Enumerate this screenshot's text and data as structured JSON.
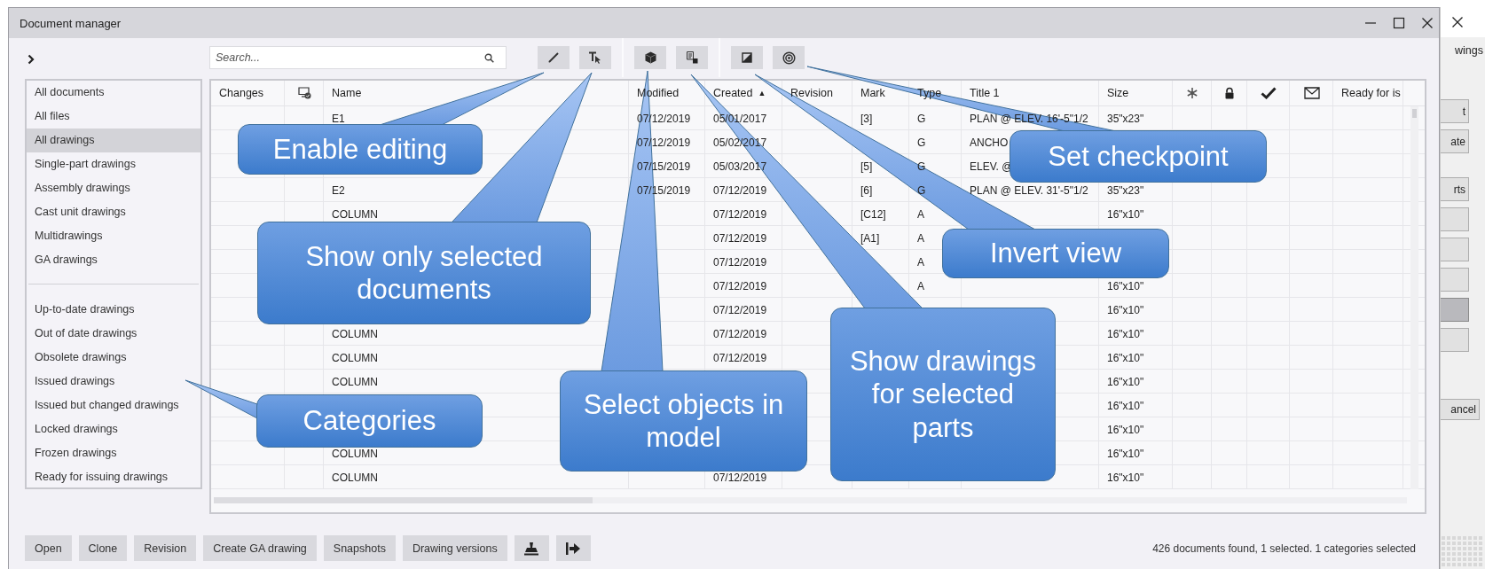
{
  "window": {
    "title": "Document manager"
  },
  "search": {
    "placeholder": "Search..."
  },
  "sidebar": {
    "groups": [
      {
        "items": [
          {
            "label": "All documents",
            "selected": false
          },
          {
            "label": "All files",
            "selected": false
          },
          {
            "label": "All drawings",
            "selected": true
          },
          {
            "label": "Single-part drawings",
            "selected": false
          },
          {
            "label": "Assembly drawings",
            "selected": false
          },
          {
            "label": "Cast unit drawings",
            "selected": false
          },
          {
            "label": "Multidrawings",
            "selected": false
          },
          {
            "label": "GA drawings",
            "selected": false
          }
        ]
      },
      {
        "items": [
          {
            "label": "Up-to-date drawings",
            "selected": false
          },
          {
            "label": "Out of date drawings",
            "selected": false
          },
          {
            "label": "Obsolete drawings",
            "selected": false
          },
          {
            "label": "Issued drawings",
            "selected": false
          },
          {
            "label": "Issued but changed drawings",
            "selected": false
          },
          {
            "label": "Locked drawings",
            "selected": false
          },
          {
            "label": "Frozen drawings",
            "selected": false
          },
          {
            "label": "Ready for issuing drawings",
            "selected": false
          }
        ]
      }
    ]
  },
  "table": {
    "columns": [
      {
        "kind": "text",
        "label": "Changes"
      },
      {
        "kind": "icon"
      },
      {
        "kind": "text",
        "label": "Name"
      },
      {
        "kind": "text",
        "label": "Modified"
      },
      {
        "kind": "text",
        "label": "Created",
        "sort_indicator": "▲"
      },
      {
        "kind": "text",
        "label": "Revision"
      },
      {
        "kind": "text",
        "label": "Mark"
      },
      {
        "kind": "text",
        "label": "Type"
      },
      {
        "kind": "text",
        "label": "Title 1"
      },
      {
        "kind": "text",
        "label": "Size"
      },
      {
        "kind": "icon"
      },
      {
        "kind": "icon"
      },
      {
        "kind": "icon"
      },
      {
        "kind": "icon"
      },
      {
        "kind": "text",
        "label": "Ready for is"
      }
    ],
    "rows": [
      {
        "cells": [
          null,
          null,
          "E1",
          "07/12/2019",
          "05/01/2017",
          null,
          "[3]",
          "G",
          "PLAN @ ELEV. 16'-5\"1/2",
          "35\"x23\""
        ]
      },
      {
        "cells": [
          null,
          null,
          null,
          "07/12/2019",
          "05/02/2017",
          null,
          null,
          "G",
          "ANCHO",
          null
        ]
      },
      {
        "cells": [
          null,
          null,
          null,
          "07/15/2019",
          "05/03/2017",
          null,
          "[5]",
          "G",
          "ELEV. @",
          null
        ]
      },
      {
        "cells": [
          null,
          null,
          "E2",
          "07/15/2019",
          "07/12/2019",
          null,
          "[6]",
          "G",
          "PLAN @ ELEV. 31'-5\"1/2",
          "35\"x23\""
        ]
      },
      {
        "cells": [
          null,
          null,
          "COLUMN",
          null,
          "07/12/2019",
          null,
          "[C12]",
          "A",
          null,
          "16\"x10\""
        ]
      },
      {
        "cells": [
          null,
          null,
          null,
          null,
          "07/12/2019",
          null,
          "[A1]",
          "A",
          null,
          null
        ]
      },
      {
        "cells": [
          null,
          null,
          null,
          null,
          "07/12/2019",
          null,
          null,
          "A",
          null,
          null
        ]
      },
      {
        "cells": [
          null,
          null,
          null,
          null,
          "07/12/2019",
          null,
          null,
          "A",
          null,
          "16\"x10\""
        ]
      },
      {
        "cells": [
          null,
          null,
          null,
          null,
          "07/12/2019",
          null,
          null,
          null,
          null,
          "16\"x10\""
        ]
      },
      {
        "cells": [
          null,
          null,
          "COLUMN",
          null,
          "07/12/2019",
          null,
          null,
          null,
          null,
          "16\"x10\""
        ]
      },
      {
        "cells": [
          null,
          null,
          "COLUMN",
          null,
          "07/12/2019",
          null,
          null,
          null,
          null,
          "16\"x10\""
        ]
      },
      {
        "cells": [
          null,
          null,
          "COLUMN",
          null,
          null,
          null,
          null,
          null,
          null,
          "16\"x10\""
        ]
      },
      {
        "cells": [
          null,
          null,
          null,
          null,
          null,
          null,
          null,
          null,
          null,
          "16\"x10\""
        ]
      },
      {
        "cells": [
          null,
          null,
          null,
          null,
          null,
          null,
          null,
          null,
          null,
          "16\"x10\""
        ]
      },
      {
        "cells": [
          null,
          null,
          "COLUMN",
          null,
          null,
          null,
          null,
          null,
          null,
          "16\"x10\""
        ]
      },
      {
        "cells": [
          null,
          null,
          "COLUMN",
          null,
          "07/12/2019",
          null,
          null,
          null,
          null,
          "16\"x10\""
        ]
      }
    ]
  },
  "bottom_bar": {
    "buttons": [
      {
        "kind": "text",
        "label": "Open"
      },
      {
        "kind": "text",
        "label": "Clone"
      },
      {
        "kind": "text",
        "label": "Revision"
      },
      {
        "kind": "text",
        "label": "Create GA drawing"
      },
      {
        "kind": "text",
        "label": "Snapshots"
      },
      {
        "kind": "text",
        "label": "Drawing versions"
      },
      {
        "kind": "icon"
      },
      {
        "kind": "icon"
      }
    ],
    "status": "426 documents found, 1 selected. 1 categories selected"
  },
  "callouts": [
    {
      "text": "Enable editing"
    },
    {
      "text": "Show only selected documents"
    },
    {
      "text": "Categories"
    },
    {
      "text": "Select objects in model"
    },
    {
      "text": "Show drawings for selected parts"
    },
    {
      "text": "Invert view"
    },
    {
      "text": "Set checkpoint"
    }
  ],
  "background_window": {
    "heading": "wings",
    "buttons": [
      {
        "kind": "text",
        "label": "t",
        "pressed": false
      },
      {
        "kind": "text",
        "label": "ate",
        "pressed": false
      },
      {
        "kind": "text",
        "label": "rts",
        "pressed": false
      },
      {
        "kind": "blank",
        "pressed": false
      },
      {
        "kind": "blank",
        "pressed": false
      },
      {
        "kind": "blank",
        "pressed": false
      },
      {
        "kind": "blank",
        "pressed": true
      },
      {
        "kind": "blank",
        "pressed": false
      },
      {
        "kind": "text",
        "label": "ancel",
        "pressed": false
      }
    ]
  }
}
